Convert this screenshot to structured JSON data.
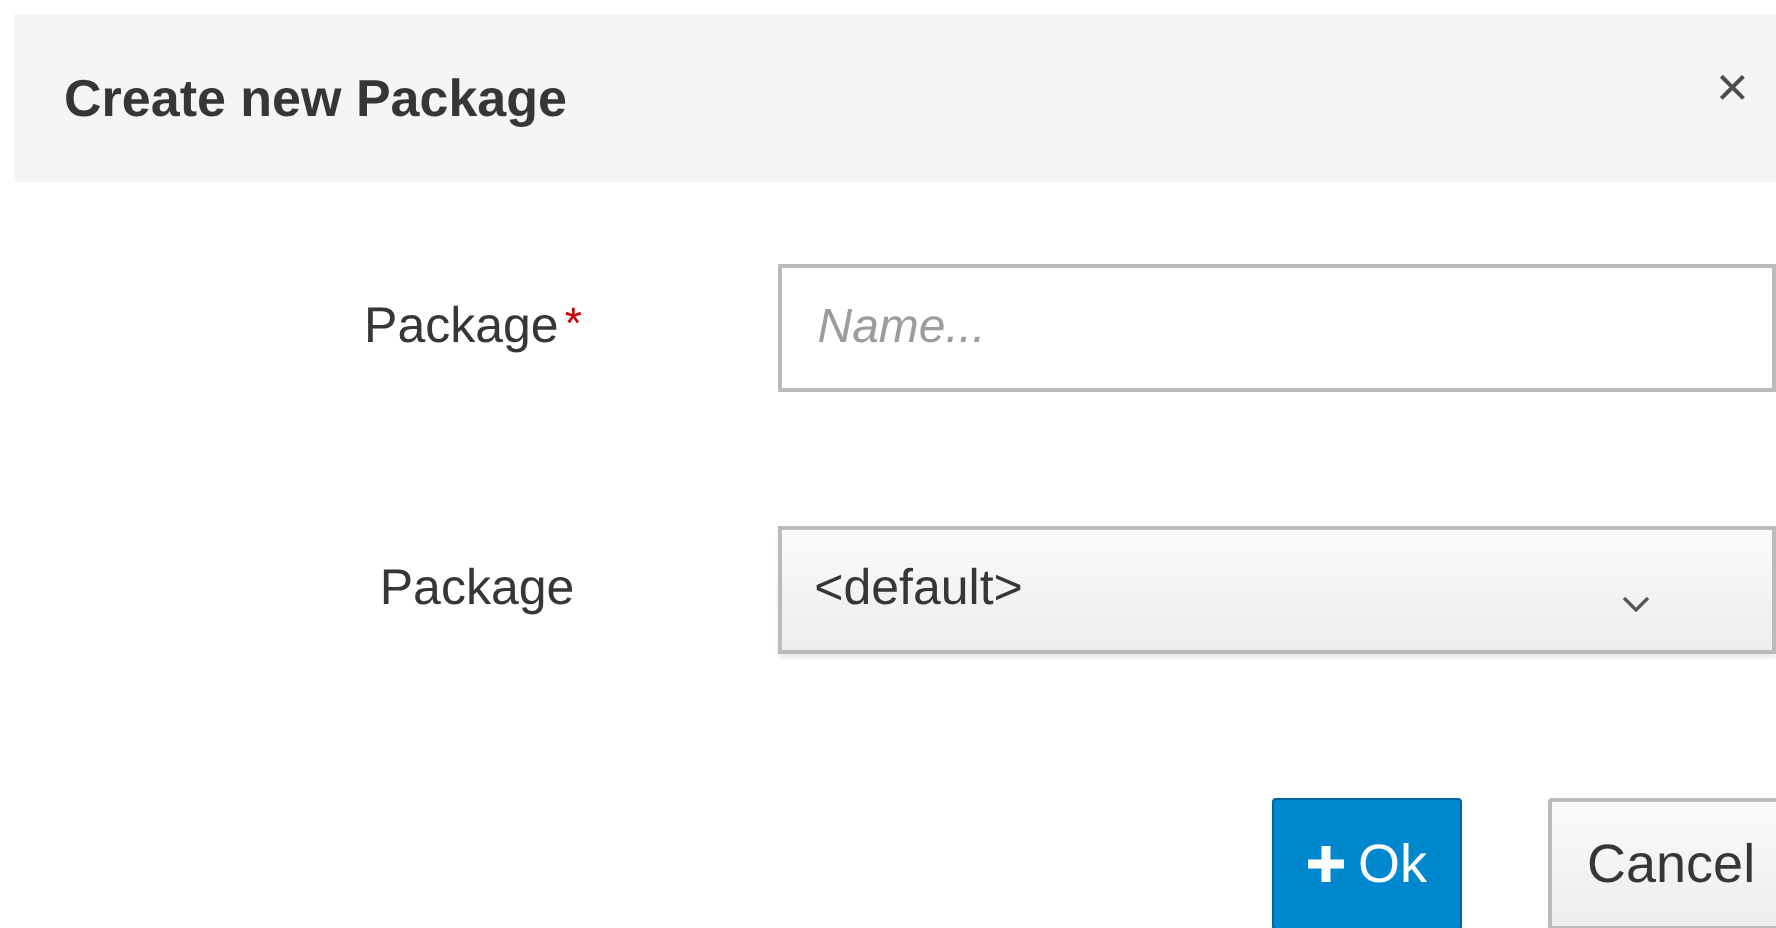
{
  "dialog": {
    "title": "Create new Package",
    "close": "×"
  },
  "fields": [
    {
      "kind": "text",
      "label": "Package",
      "required_mark": "*",
      "placeholder": "Name..."
    },
    {
      "kind": "select",
      "label": "Package",
      "value": "<default>"
    }
  ],
  "buttons": [
    {
      "kind": "primary",
      "label": "Ok"
    },
    {
      "kind": "default",
      "label": "Cancel"
    }
  ]
}
